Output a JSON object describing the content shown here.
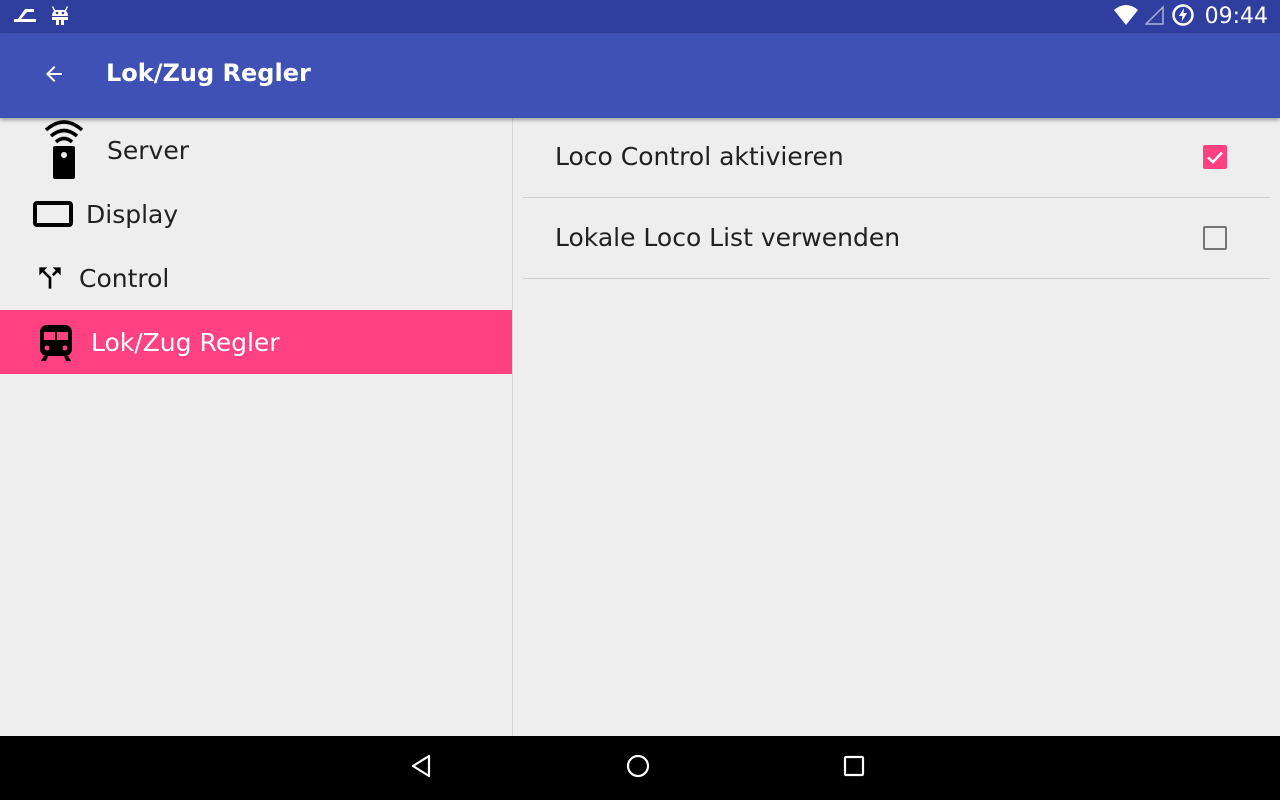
{
  "status_bar": {
    "time": "09:44",
    "left_icons": [
      "usb-debug-icon",
      "android-debug-icon"
    ],
    "right_icons": [
      "wifi-icon",
      "cell-signal-icon",
      "battery-charging-icon"
    ]
  },
  "app_bar": {
    "title": "Lok/Zug Regler",
    "back_icon": "arrow-back-icon",
    "color": "#3f51b5"
  },
  "sidebar": {
    "items": [
      {
        "label": "Server",
        "icon": "remote-wifi-icon",
        "selected": false
      },
      {
        "label": "Display",
        "icon": "display-icon",
        "selected": false
      },
      {
        "label": "Control",
        "icon": "call-split-icon",
        "selected": false
      },
      {
        "label": "Lok/Zug Regler",
        "icon": "train-icon",
        "selected": true
      }
    ],
    "selected_color": "#ff4081"
  },
  "preferences": [
    {
      "title": "Loco Control aktivieren",
      "checked": true
    },
    {
      "title": "Lokale Loco List verwenden",
      "checked": false
    }
  ],
  "nav_bar": {
    "buttons": [
      "back-triangle-icon",
      "home-circle-icon",
      "recents-square-icon"
    ]
  }
}
